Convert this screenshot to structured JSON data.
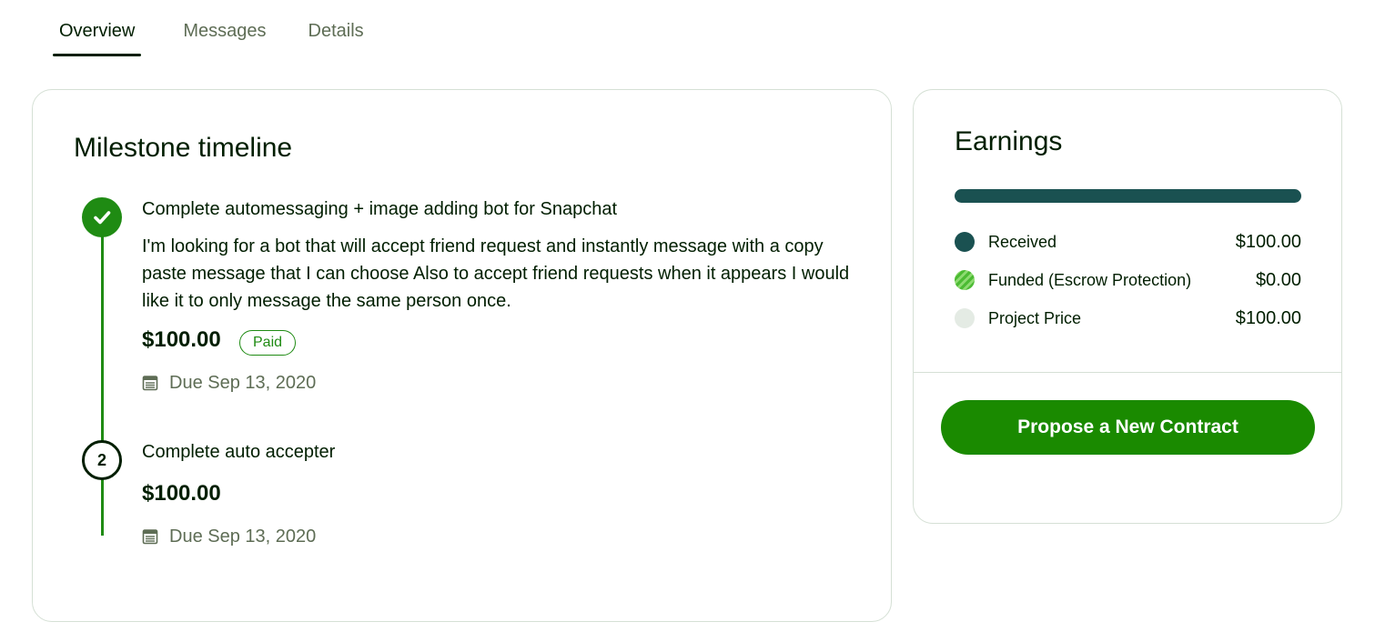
{
  "tabs": [
    {
      "label": "Overview",
      "active": true
    },
    {
      "label": "Messages",
      "active": false
    },
    {
      "label": "Details",
      "active": false
    }
  ],
  "milestones": {
    "title": "Milestone timeline",
    "items": [
      {
        "step": "1",
        "status": "done",
        "title": "Complete automessaging + image adding bot for Snapchat",
        "description": "I'm looking for a bot that will accept friend request and instantly message with a copy paste message that I can choose Also to accept friend requests when it appears I would like it to only message the same person once.",
        "amount": "$100.00",
        "badge": "Paid",
        "due": "Due Sep 13, 2020"
      },
      {
        "step": "2",
        "status": "pending",
        "title": "Complete auto accepter",
        "amount": "$100.00",
        "due": "Due Sep 13, 2020"
      }
    ]
  },
  "earnings": {
    "title": "Earnings",
    "received_fraction": 1.0,
    "legend": [
      {
        "label": "Received",
        "value": "$100.00",
        "color": "#1a5151"
      },
      {
        "label": "Funded (Escrow Protection)",
        "value": "$0.00",
        "color": "#4cbb33"
      },
      {
        "label": "Project Price",
        "value": "$100.00",
        "color": "#e4ebe4"
      }
    ],
    "propose_button": "Propose a New Contract"
  },
  "colors": {
    "accent": "#1f8b13",
    "button": "#1a8a00",
    "text": "#001e00",
    "muted": "#5e6d55"
  }
}
